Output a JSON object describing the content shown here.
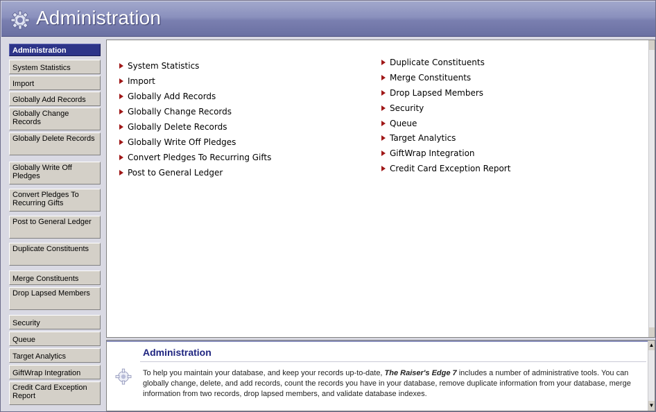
{
  "header": {
    "title": "Administration"
  },
  "sidebar": {
    "items": [
      {
        "label": "Administration",
        "active": true
      },
      {
        "label": "System Statistics"
      },
      {
        "label": "Import"
      },
      {
        "label": "Globally Add Records"
      },
      {
        "label": "Globally Change Records"
      },
      {
        "label": "Globally Delete Records"
      },
      {
        "label": "Globally Write Off Pledges"
      },
      {
        "label": "Convert Pledges To Recurring Gifts"
      },
      {
        "label": "Post to General Ledger"
      },
      {
        "label": "Duplicate Constituents"
      },
      {
        "label": "Merge Constituents"
      },
      {
        "label": "Drop Lapsed Members"
      },
      {
        "label": "Security"
      },
      {
        "label": "Queue"
      },
      {
        "label": "Target Analytics"
      },
      {
        "label": "GiftWrap Integration"
      },
      {
        "label": "Credit Card Exception Report"
      }
    ]
  },
  "main": {
    "left_links": [
      "System Statistics",
      "Import",
      "Globally Add Records",
      "Globally Change Records",
      "Globally Delete Records",
      "Globally Write Off Pledges",
      "Convert Pledges To Recurring Gifts",
      "Post to General Ledger"
    ],
    "right_links": [
      "Duplicate Constituents",
      "Merge Constituents",
      "Drop Lapsed Members",
      "Security",
      "Queue",
      "Target Analytics",
      "GiftWrap Integration",
      "Credit Card Exception Report"
    ]
  },
  "description": {
    "heading": "Administration",
    "text_before": "To help you maintain your database, and keep your records up-to-date, ",
    "product": "The Raiser's Edge 7",
    "text_after": " includes a number of administrative tools. You can globally change, delete, and add records, count the records you have in your database, remove duplicate information from your database, merge information from two records, drop lapsed members, and validate database indexes."
  },
  "colors": {
    "header": "#7a7fb0",
    "active_nav": "#2d3489",
    "arrow": "#a01818",
    "heading": "#1f2580"
  },
  "icons": {
    "header": "gear-icon",
    "description": "gear-icon"
  }
}
